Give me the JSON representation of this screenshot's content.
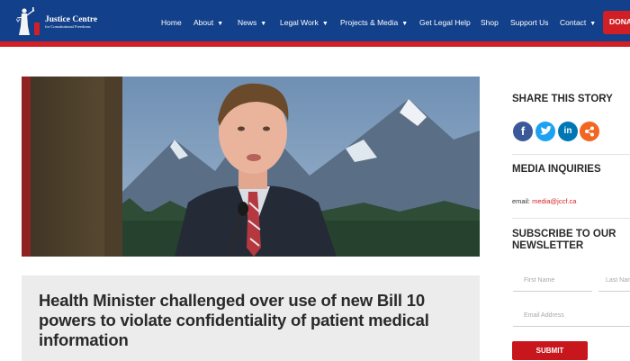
{
  "brand": {
    "title": "Justice Centre",
    "subtitle": "for Constitutional Freedoms"
  },
  "nav": {
    "items": [
      {
        "label": "Home"
      },
      {
        "label": "About",
        "dropdown": true
      },
      {
        "label": "News",
        "dropdown": true
      },
      {
        "label": "Legal Work",
        "dropdown": true
      },
      {
        "label": "Projects & Media",
        "dropdown": true
      },
      {
        "label": "Get Legal Help"
      },
      {
        "label": "Shop"
      },
      {
        "label": "Support Us"
      },
      {
        "label": "Contact",
        "dropdown": true
      }
    ],
    "donate_label": "DONATE"
  },
  "article": {
    "title": "Health Minister challenged over use of new Bill 10 powers to violate confidentiality of patient medical information"
  },
  "sidebar": {
    "share_heading": "SHARE THIS STORY",
    "share_icons": [
      "facebook-icon",
      "twitter-icon",
      "linkedin-icon",
      "share-icon"
    ],
    "media_heading": "MEDIA INQUIRIES",
    "email_prefix": "email:",
    "email_value": "media@jccf.ca",
    "subscribe_heading": "SUBSCRIBE TO OUR NEWSLETTER",
    "first_name_placeholder": "First Name",
    "last_name_placeholder": "Last Name",
    "email_placeholder": "Email Address",
    "submit_label": "SUBMIT"
  },
  "colors": {
    "header_blue": "#12408a",
    "accent_red": "#d21f26",
    "title_box_bg": "#ececec"
  }
}
